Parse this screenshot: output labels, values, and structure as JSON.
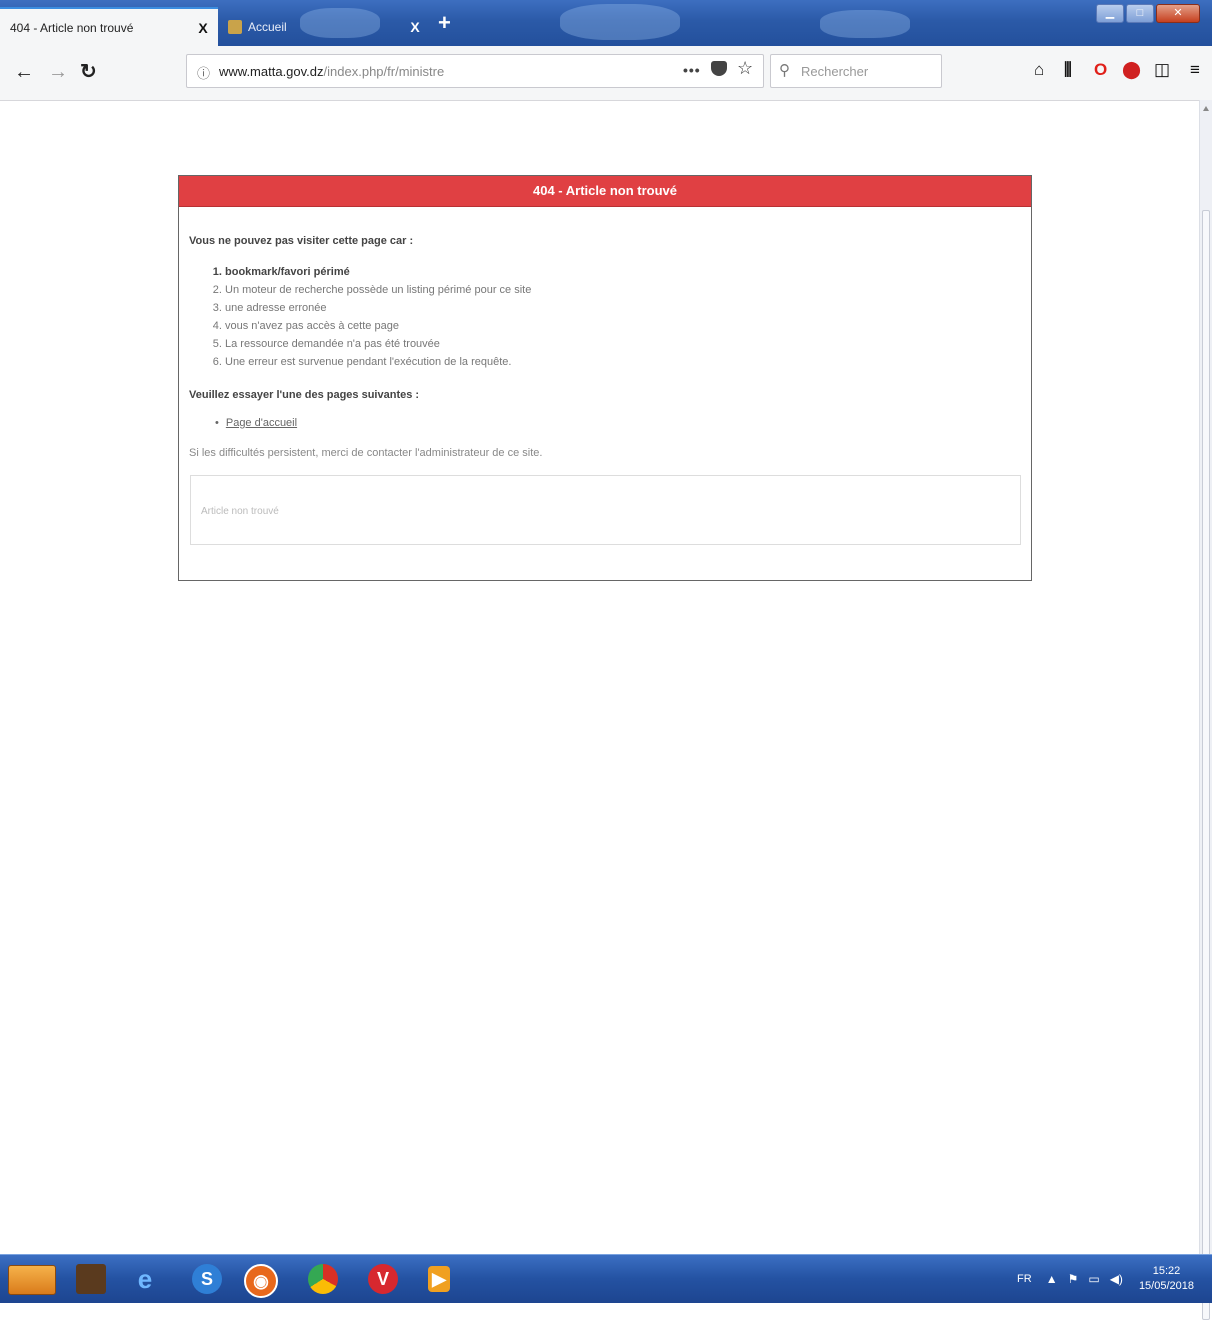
{
  "browser": {
    "tabs": [
      {
        "title": "404 - Article non trouvé",
        "close": "X"
      },
      {
        "title": "Accueil",
        "close": "X"
      }
    ],
    "new_tab": "+",
    "url_domain": "www.matta.gov.dz",
    "url_path": "/index.php/fr/ministre",
    "page_actions": "•••",
    "search_placeholder": "Rechercher"
  },
  "page": {
    "header": "404 - Article non trouvé",
    "lead": "Vous ne pouvez pas visiter cette page car :",
    "reasons": [
      "bookmark/favori périmé",
      "Un moteur de recherche possède un listing périmé pour ce site",
      "une adresse erronée",
      "vous n'avez pas accès à cette page",
      "La ressource demandée n'a pas été trouvée",
      "Une erreur est survenue pendant l'exécution de la requête."
    ],
    "try_pages": "Veuillez essayer l'une des pages suivantes :",
    "home_link": "Page d'accueil",
    "contact_note": "Si les difficultés persistent, merci de contacter l'administrateur de ce site.",
    "panel_text": "Article non trouvé"
  },
  "taskbar": {
    "lang": "FR",
    "time": "15:22",
    "date": "15/05/2018"
  },
  "colors": {
    "error_header": "#e04043",
    "taskbar": "#2452a2"
  }
}
